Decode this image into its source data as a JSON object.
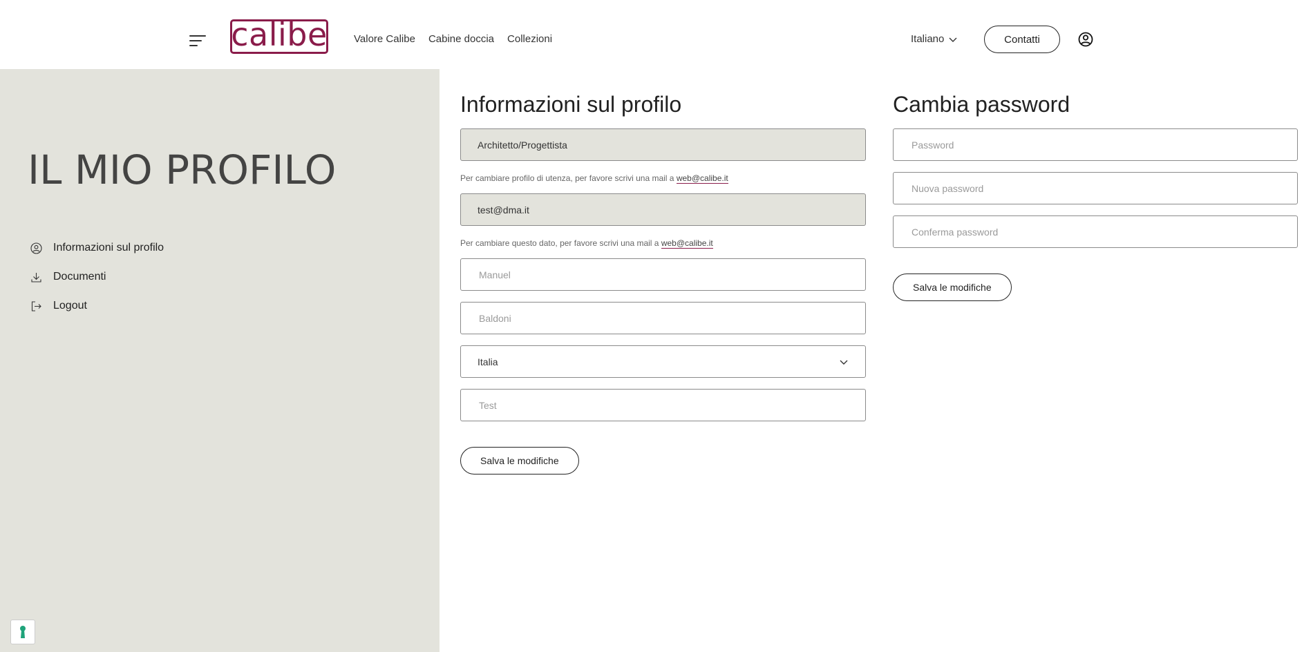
{
  "header": {
    "brand": "calibe",
    "nav": [
      "Valore Calibe",
      "Cabine doccia",
      "Collezioni"
    ],
    "language": "Italiano",
    "contact_label": "Contatti"
  },
  "sidebar": {
    "title": "IL MIO PROFILO",
    "items": [
      {
        "label": "Informazioni sul profilo",
        "icon": "user-circle-icon"
      },
      {
        "label": "Documenti",
        "icon": "download-icon"
      },
      {
        "label": "Logout",
        "icon": "logout-icon"
      }
    ]
  },
  "profile": {
    "title": "Informazioni sul profilo",
    "profile_type": "Architetto/Progettista",
    "profile_hint": "Per cambiare profilo di utenza, per favore scrivi una mail a",
    "email": "test@dma.it",
    "email_hint": "Per cambiare questo dato, per favore scrivi una mail a",
    "contact_email": "web@calibe.it",
    "first_name_placeholder": "Manuel",
    "last_name_placeholder": "Baldoni",
    "country": "Italia",
    "company_placeholder": "Test",
    "save_label": "Salva le modifiche"
  },
  "password": {
    "title": "Cambia password",
    "current_placeholder": "Password",
    "new_placeholder": "Nuova password",
    "confirm_placeholder": "Conferma password",
    "save_label": "Salva le modifiche"
  },
  "colors": {
    "brand": "#8a1c4a",
    "sidebar_bg": "#e3e3dc",
    "cookie_green": "#1fa37a"
  }
}
